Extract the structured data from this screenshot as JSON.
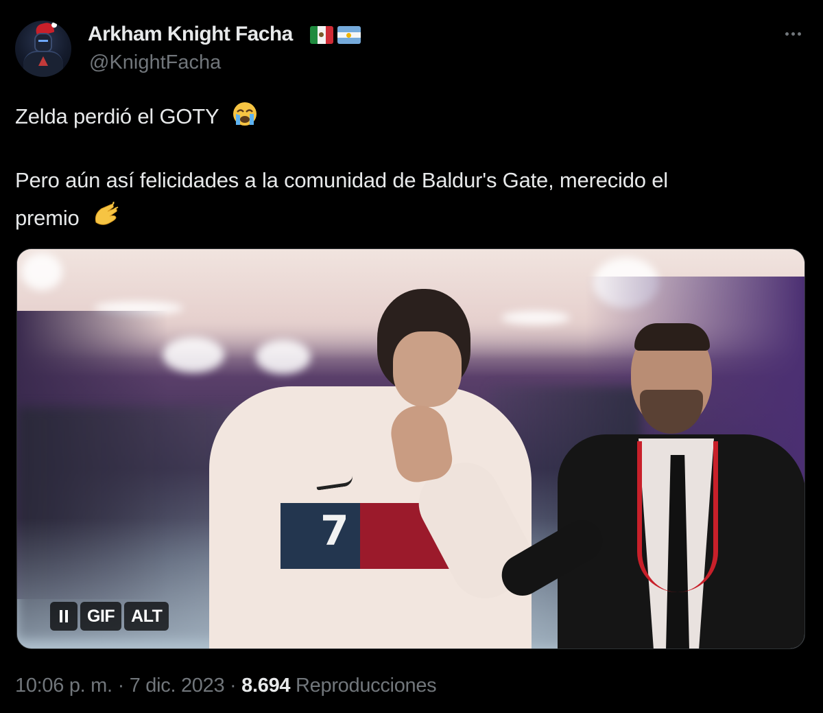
{
  "tweet": {
    "author": {
      "display_name": "Arkham Knight Facha",
      "handle": "@KnightFacha",
      "avatar_icon": "batman-avatar-icon",
      "flag_icons": [
        "mexico-flag-icon",
        "argentina-flag-icon"
      ]
    },
    "more_icon": "more-options-icon",
    "text_lines": [
      "Zelda perdió el GOTY",
      "Pero aún así felicidades a la comunidad de Baldur's Gate, merecido el",
      "premio"
    ],
    "emojis": {
      "crying": "loudly-crying-face",
      "clapping": "clapping-hands"
    },
    "media": {
      "type": "gif",
      "badges": {
        "gif": "GIF",
        "alt": "ALT"
      },
      "pause_icon": "pause-icon",
      "jersey_number": "7"
    },
    "meta": {
      "time": "10:06 p. m.",
      "separator": "·",
      "date": "7 dic. 2023",
      "views_count": "8.694",
      "views_label": "Reproducciones"
    }
  }
}
